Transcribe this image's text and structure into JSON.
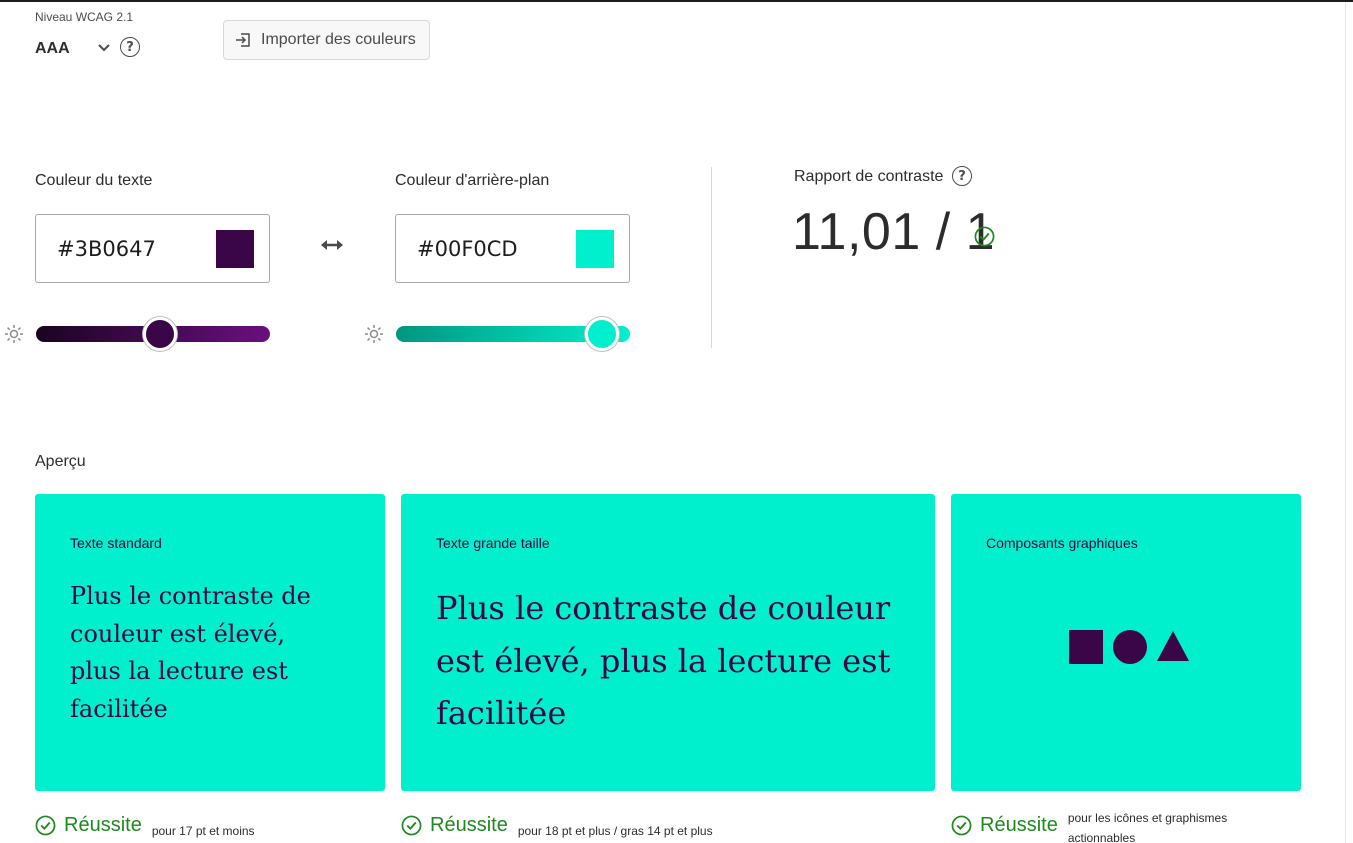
{
  "wcag": {
    "label": "Niveau WCAG 2.1",
    "value": "AAA"
  },
  "import_button": {
    "label": "Importer des couleurs"
  },
  "text_color": {
    "label": "Couleur du texte",
    "hex": "#3B0647",
    "swatch": "#3B0647",
    "slider_gradient": [
      "#1a0420",
      "#6a0f80"
    ],
    "brightness": 0.53
  },
  "bg_color": {
    "label": "Couleur d'arrière-plan",
    "hex": "#00F0CD",
    "swatch": "#00F0CD",
    "slider_gradient": [
      "#00967f",
      "#00f0cd"
    ],
    "brightness": 0.88
  },
  "contrast": {
    "label": "Rapport de contraste",
    "value": "11,01 / 1"
  },
  "preview": {
    "label": "Aperçu",
    "card_bg": "#00F0CD",
    "fg": "#3B0647",
    "cards": [
      {
        "title": "Texte standard",
        "text": "Plus le contraste de couleur est élevé, plus la lecture est facilitée"
      },
      {
        "title": "Texte grande taille",
        "text": "Plus le contraste de couleur est élevé, plus la lecture est facilitée"
      },
      {
        "title": "Composants graphiques"
      }
    ]
  },
  "results": [
    {
      "status": "Réussite",
      "note": "pour 17 pt et moins"
    },
    {
      "status": "Réussite",
      "note": "pour 18 pt et plus / gras 14 pt et plus"
    },
    {
      "status": "Réussite",
      "note": "pour les icônes et graphismes actionnables"
    }
  ],
  "colors": {
    "pass": "#1e8a1e",
    "text": "#2c2c2c",
    "muted": "#4b4b4b"
  },
  "icons": [
    "chevron-down-icon",
    "help-icon",
    "import-icon",
    "swap-icon",
    "sun-icon",
    "check-circle-icon",
    "square-icon",
    "circle-icon",
    "triangle-icon"
  ]
}
